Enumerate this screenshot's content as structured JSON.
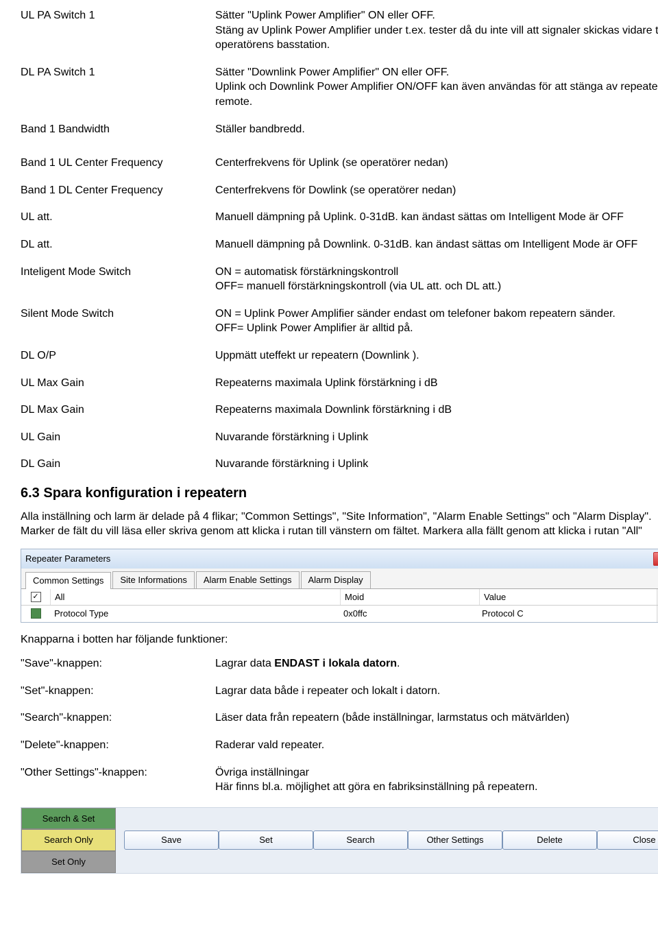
{
  "defs1": [
    {
      "term": "UL PA Switch 1",
      "desc": "Sätter \"Uplink Power Amplifier\" ON eller OFF.\nStäng av Uplink Power Amplifier under t.ex. tester då du inte vill att signaler skickas vidare till operatörens basstation."
    },
    {
      "term": "DL PA Switch 1",
      "desc": "Sätter \"Downlink Power Amplifier\"  ON eller OFF.\nUplink och Downlink Power Amplifier ON/OFF kan även användas för att stänga av repeatern remote."
    },
    {
      "term": "Band 1 Bandwidth",
      "desc": "Ställer bandbredd."
    }
  ],
  "defs2": [
    {
      "term": "Band 1 UL Center Frequency",
      "desc": "Centerfrekvens för Uplink (se operatörer nedan)"
    },
    {
      "term": "Band 1 DL Center Frequency",
      "desc": "Centerfrekvens för Dowlink (se operatörer nedan)"
    },
    {
      "term": "UL att.",
      "desc": "Manuell dämpning på Uplink. 0-31dB. kan ändast sättas om Intelligent Mode är OFF"
    },
    {
      "term": "DL att.",
      "desc": "Manuell dämpning på Downlink. 0-31dB. kan ändast sättas om Intelligent Mode är OFF"
    },
    {
      "term": "Inteligent Mode Switch",
      "desc": "ON = automatisk förstärkningskontroll\nOFF= manuell förstärkningskontroll (via UL att. och DL att.)"
    },
    {
      "term": "Silent Mode Switch",
      "desc": "ON =  Uplink Power Amplifier sänder endast om telefoner bakom repeatern sänder.\nOFF= Uplink Power Amplifier är alltid på."
    },
    {
      "term": "DL O/P",
      "desc": "Uppmätt uteffekt ur repeatern (Downlink )."
    },
    {
      "term": "UL Max Gain",
      "desc": "Repeaterns maximala Uplink förstärkning i dB"
    },
    {
      "term": "DL Max Gain",
      "desc": "Repeaterns maximala Downlink förstärkning i dB"
    },
    {
      "term": "UL Gain",
      "desc": "Nuvarande förstärkning i Uplink"
    },
    {
      "term": "DL Gain",
      "desc": "Nuvarande förstärkning i Uplink"
    }
  ],
  "section_heading": "6.3 Spara konfiguration i repeatern",
  "section_para": "Alla inställning och larm är delade på 4 flikar; \"Common Settings\", \"Site Information\", \"Alarm Enable Settings\" och  \"Alarm Display\". Marker de fält du vill läsa eller skriva genom att klicka i rutan till vänstern om fältet. Markera alla fällt genom att klicka i rutan \"All\"",
  "win": {
    "title": "Repeater Parameters",
    "tabs": [
      "Common Settings",
      "Site Informations",
      "Alarm Enable Settings",
      "Alarm Display"
    ],
    "head": {
      "c1": "All",
      "c2": "Moid",
      "c3": "Value"
    },
    "row": {
      "c1": "Protocol Type",
      "c2": "0x0ffc",
      "c3": "Protocol C"
    }
  },
  "after_win": "Knapparna i botten har följande funktioner:",
  "btns": [
    {
      "term": "\"Save\"-knappen:",
      "desc_pre": "Lagrar data ",
      "desc_bold": "ENDAST i lokala datorn",
      "desc_post": "."
    },
    {
      "term": "\"Set\"-knappen:",
      "desc": "Lagrar data både i repeater och lokalt i datorn."
    },
    {
      "term": "\"Search\"-knappen:",
      "desc": "Läser data från repeatern (både inställningar, larmstatus och mätvärlden)"
    },
    {
      "term": "\"Delete\"-knappen:",
      "desc": "Raderar vald repeater."
    },
    {
      "term": "\"Other Settings\"-knappen:",
      "desc": "Övriga inställningar\nHär finns bl.a. möjlighet att göra en fabriksinställning på repeatern."
    }
  ],
  "bar": {
    "left": [
      "Search & Set",
      "Search Only",
      "Set  Only"
    ],
    "main": [
      "Save",
      "Set",
      "Search",
      "Other Settings",
      "Delete",
      "Close"
    ]
  }
}
